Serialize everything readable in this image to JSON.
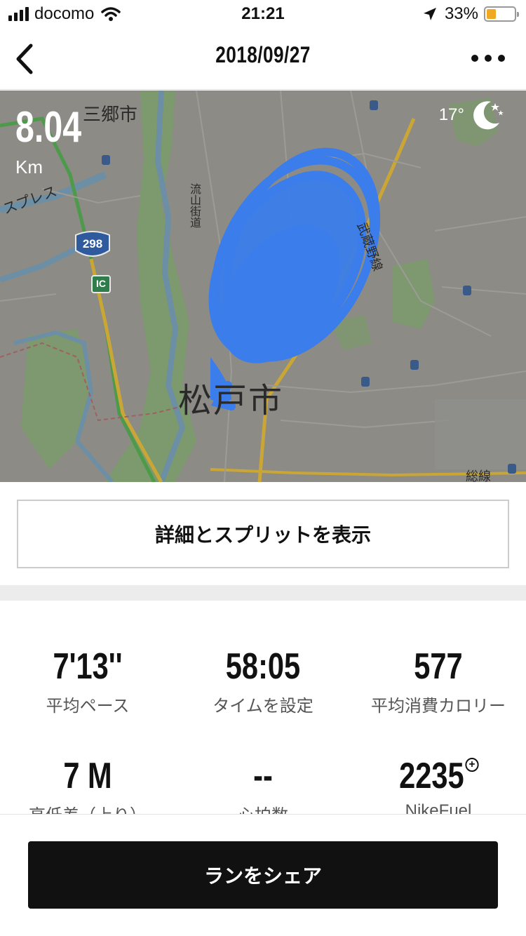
{
  "status_bar": {
    "carrier": "docomo",
    "time": "21:21",
    "battery_percent": "33%",
    "battery_level": 0.33,
    "battery_color": "#f0a922",
    "icons": [
      "signal-icon",
      "wifi-icon",
      "location-arrow-icon",
      "battery-icon"
    ]
  },
  "nav": {
    "title": "2018/09/27",
    "back_icon": "chevron-left-icon",
    "more_icon": "more-dots-icon"
  },
  "map": {
    "distance_value": "8.04",
    "distance_unit": "Km",
    "temperature": "17°",
    "weather_icon": "moon-stars-icon",
    "route_color": "#3b7dea",
    "place_labels": {
      "misato": "三郷市",
      "matsudo": "松戸市",
      "nagareyama_road": "流山街道",
      "musashino_line": "武蔵野線",
      "express": "スプレス",
      "sobu_line": "総線"
    },
    "shields": {
      "route_298": "298",
      "ic": "IC"
    }
  },
  "details_button": "詳細とスプリットを表示",
  "stats": [
    {
      "value": "7'13''",
      "label": "平均ペース"
    },
    {
      "value": "58:05",
      "label": "タイムを設定"
    },
    {
      "value": "577",
      "label": "平均消費カロリー"
    },
    {
      "value": "7 M",
      "label": "高低差（上り）"
    },
    {
      "value": "--",
      "label": "心拍数"
    },
    {
      "value": "2235",
      "label": "NikeFuel"
    }
  ],
  "share_button": "ランをシェア"
}
